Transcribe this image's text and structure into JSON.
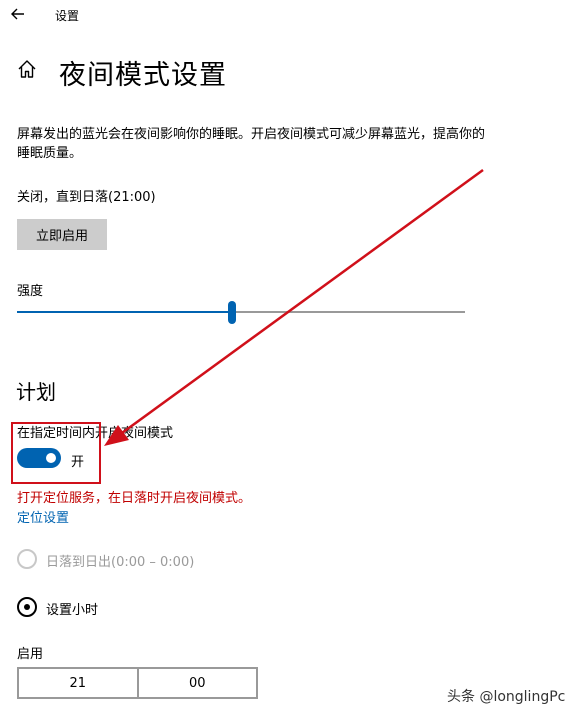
{
  "titlebar": {
    "back_icon": "back-arrow-icon",
    "title": "设置"
  },
  "header": {
    "home_icon": "home-icon",
    "title": "夜间模式设置"
  },
  "description": "屏幕发出的蓝光会在夜间影响你的睡眠。开启夜间模式可减少屏幕蓝光，提高你的睡眠质量。",
  "status": "关闭，直到日落(21:00)",
  "enable_button": "立即启用",
  "strength": {
    "label": "强度",
    "value_fraction": 0.48
  },
  "schedule": {
    "heading": "计划",
    "toggle_label": "在指定时间内开启夜间模式",
    "toggle_state": "开",
    "toggle_on": true,
    "warning": "打开定位服务，在日落时开启夜间模式。",
    "location_link": "定位设置",
    "option_sunset": "日落到日出(0:00 – 0:00)",
    "option_hours": "设置小时",
    "selected_option": "option_hours",
    "on_label": "启用",
    "hour": "21",
    "minute": "00"
  },
  "watermark": "头条 @longlingPc",
  "colors": {
    "accent": "#0063b1",
    "annotation_red": "#d0101a",
    "warning_red": "#c00000"
  }
}
